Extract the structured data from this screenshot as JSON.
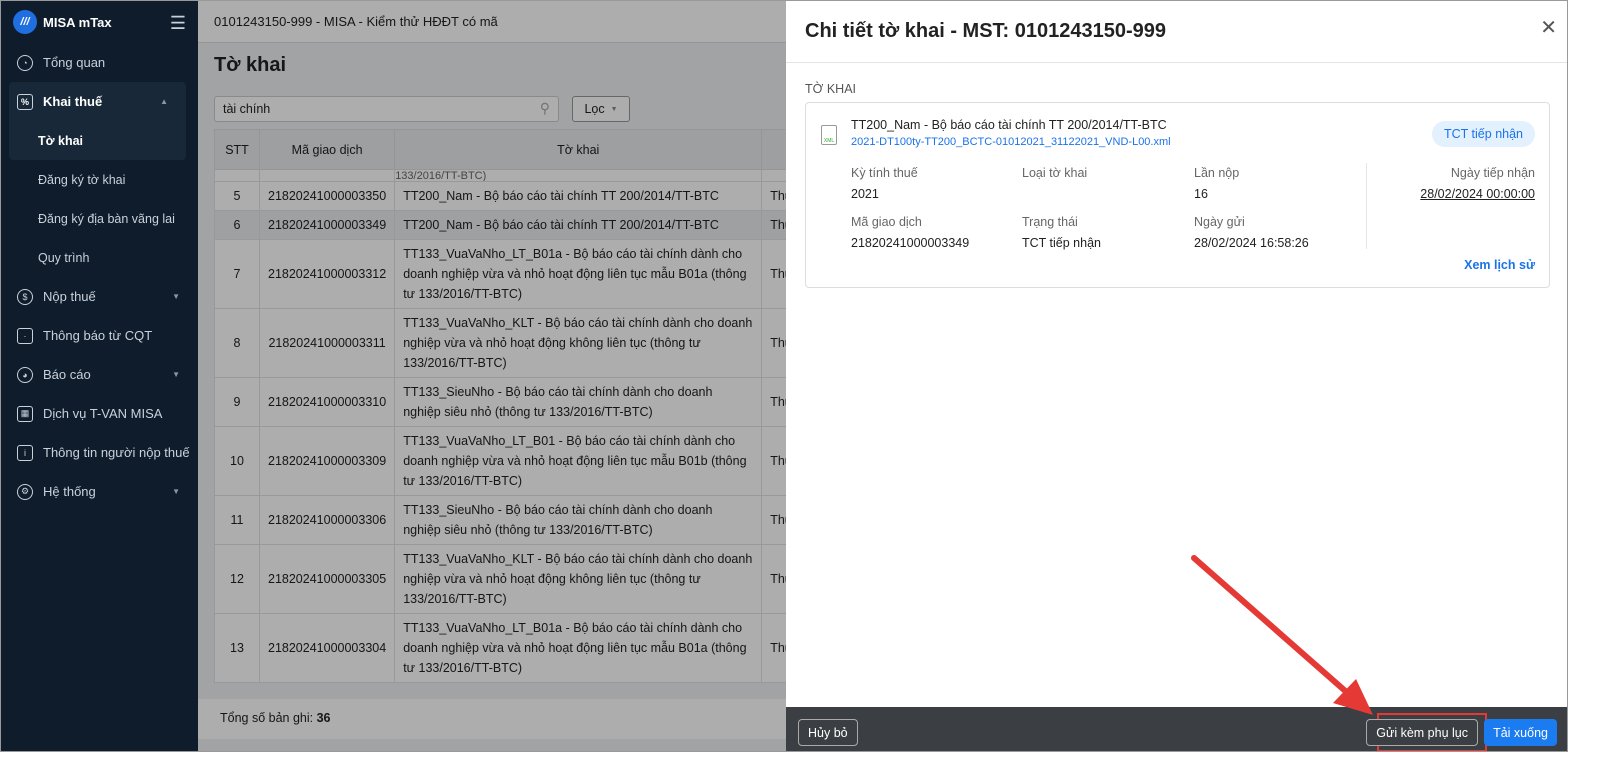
{
  "sidebar": {
    "brand": "MISA mTax",
    "items": [
      {
        "label": "Tổng quan"
      },
      {
        "label": "Khai thuế"
      },
      {
        "label": "Nộp thuế"
      },
      {
        "label": "Thông báo từ CQT"
      },
      {
        "label": "Báo cáo"
      },
      {
        "label": "Dịch vụ T-VAN MISA"
      },
      {
        "label": "Thông tin người nộp thuế"
      },
      {
        "label": "Hệ thống"
      }
    ],
    "sub": [
      "Tờ khai",
      "Đăng ký tờ khai",
      "Đăng ký địa bàn vãng lai",
      "Quy trình"
    ]
  },
  "header": {
    "company": "0101243150-999 - MISA - Kiểm thử HĐĐT có mã"
  },
  "page": {
    "title": "Tờ khai",
    "search_value": "tài chính",
    "filter_label": "Lọc",
    "total_label": "Tổng số bản ghi:",
    "total": "36"
  },
  "table": {
    "headers": [
      "STT",
      "Mã giao dịch",
      "Tờ khai"
    ],
    "partial_top": "133/2016/TT-BTC)",
    "col4": "Thu",
    "rows": [
      [
        "5",
        "21820241000003350",
        "TT200_Nam - Bộ báo cáo tài chính TT 200/2014/TT-BTC"
      ],
      [
        "6",
        "21820241000003349",
        "TT200_Nam - Bộ báo cáo tài chính TT 200/2014/TT-BTC"
      ],
      [
        "7",
        "21820241000003312",
        "TT133_VuaVaNho_LT_B01a - Bộ báo cáo tài chính dành cho doanh nghiệp vừa và nhỏ hoạt động liên tục mẫu B01a (thông tư 133/2016/TT-BTC)"
      ],
      [
        "8",
        "21820241000003311",
        "TT133_VuaVaNho_KLT - Bộ báo cáo tài chính dành cho doanh nghiệp vừa và nhỏ hoạt động không liên tục (thông tư 133/2016/TT-BTC)"
      ],
      [
        "9",
        "21820241000003310",
        "TT133_SieuNho - Bộ báo cáo tài chính dành cho doanh nghiệp siêu nhỏ (thông tư 133/2016/TT-BTC)"
      ],
      [
        "10",
        "21820241000003309",
        "TT133_VuaVaNho_LT_B01 - Bộ báo cáo tài chính dành cho doanh nghiệp vừa và nhỏ hoạt động liên tục mẫu B01b (thông tư 133/2016/TT-BTC)"
      ],
      [
        "11",
        "21820241000003306",
        "TT133_SieuNho - Bộ báo cáo tài chính dành cho doanh nghiệp siêu nhỏ (thông tư 133/2016/TT-BTC)"
      ],
      [
        "12",
        "21820241000003305",
        "TT133_VuaVaNho_KLT - Bộ báo cáo tài chính dành cho doanh nghiệp vừa và nhỏ hoạt động không liên tục (thông tư 133/2016/TT-BTC)"
      ],
      [
        "13",
        "21820241000003304",
        "TT133_VuaVaNho_LT_B01a - Bộ báo cáo tài chính dành cho doanh nghiệp vừa và nhỏ hoạt động liên tục mẫu B01a (thông tư 133/2016/TT-BTC)"
      ]
    ]
  },
  "drawer": {
    "title": "Chi tiết tờ khai - MST: 0101243150-999",
    "section": "TỜ KHAI",
    "name": "TT200_Nam - Bộ báo cáo tài chính TT 200/2014/TT-BTC",
    "file": "2021-DT100ty-TT200_BCTC-01012021_31122021_VND-L00.xml",
    "status_badge": "TCT tiếp nhận",
    "fields": {
      "ky_label": "Kỳ tính thuế",
      "ky": "2021",
      "loai_label": "Loại tờ khai",
      "lan_label": "Lần nộp",
      "lan": "16",
      "ma_label": "Mã giao dịch",
      "ma": "21820241000003349",
      "tt_label": "Trạng thái",
      "tt": "TCT tiếp nhận",
      "gui_label": "Ngày gửi",
      "gui": "28/02/2024 16:58:26",
      "nhan_label": "Ngày tiếp nhận",
      "nhan": "28/02/2024 00:00:00"
    },
    "history": "Xem lịch sử",
    "cancel": "Hủy bỏ",
    "attach": "Gửi kèm phụ lục",
    "download": "Tải xuống"
  }
}
